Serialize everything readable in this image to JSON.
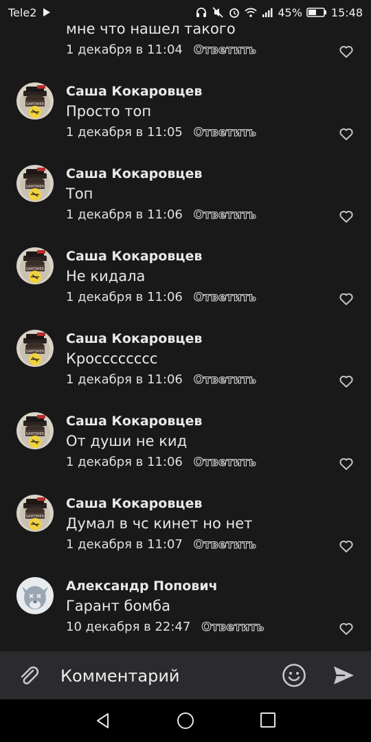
{
  "status": {
    "carrier": "Tele2",
    "battery": "45%",
    "time": "15:48"
  },
  "partial_comment": {
    "text": "мне что нашел такого",
    "date": "1 декабря в 11:04",
    "reply": "Ответить"
  },
  "comments": [
    {
      "name": "Саша Кокаровцев",
      "text": "Просто топ",
      "date": "1 декабря в 11:05",
      "reply": "Ответить"
    },
    {
      "name": "Саша Кокаровцев",
      "text": "Топ",
      "date": "1 декабря в 11:06",
      "reply": "Ответить"
    },
    {
      "name": "Саша Кокаровцев",
      "text": "Не кидала",
      "date": "1 декабря в 11:06",
      "reply": "Ответить"
    },
    {
      "name": "Саша Кокаровцев",
      "text": "Кросссссссс",
      "date": "1 декабря в 11:06",
      "reply": "Ответить"
    },
    {
      "name": "Саша Кокаровцев",
      "text": "От души не кид",
      "date": "1 декабря в 11:06",
      "reply": "Ответить"
    },
    {
      "name": "Саша Кокаровцев",
      "text": "Думал в чс кинет но нет",
      "date": "1 декабря в 11:07",
      "reply": "Ответить"
    },
    {
      "name": "Александр Попович",
      "text": "Гарант бомба",
      "date": "10 декабря в 22:47",
      "reply": "Ответить"
    }
  ],
  "composer": {
    "placeholder": "Комментарий"
  },
  "icons": {
    "attach": "paperclip-icon",
    "emoji": "smiley-icon",
    "send": "send-icon",
    "like": "heart-outline-icon",
    "deleted_avatar": "deactivated-dog-icon"
  },
  "colors": {
    "background": "#19191a",
    "composer": "#2b2b2d",
    "text": "#e9e9ea",
    "icon": "#c7c7c9"
  }
}
